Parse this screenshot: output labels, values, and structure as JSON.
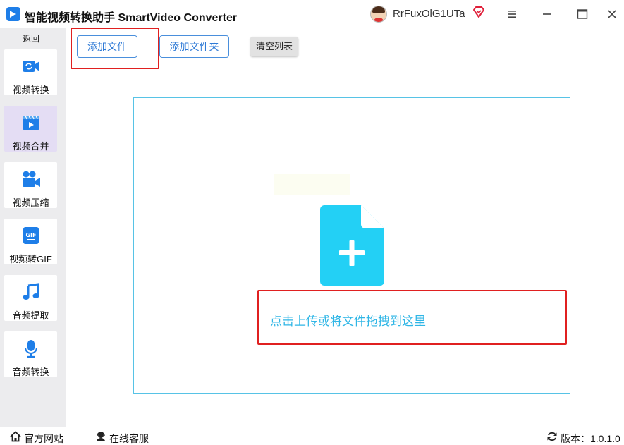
{
  "app": {
    "title": "智能视频转换助手 SmartVideo Converter",
    "username": "RrFuxOlG1UTa",
    "accent": "#2f7ad6"
  },
  "window_controls": {
    "icons": [
      "vip-diamond-icon",
      "menu-icon",
      "minimize-icon",
      "maximize-icon",
      "close-icon"
    ]
  },
  "sidebar": {
    "back_label": "返回",
    "items": [
      {
        "label": "视频转换",
        "icon": "video-convert-icon",
        "active": false
      },
      {
        "label": "视频合并",
        "icon": "video-merge-icon",
        "active": true
      },
      {
        "label": "视频压缩",
        "icon": "video-compress-icon",
        "active": false
      },
      {
        "label": "视频转GIF",
        "icon": "gif-icon",
        "active": false
      },
      {
        "label": "音频提取",
        "icon": "music-note-icon",
        "active": false
      },
      {
        "label": "音频转换",
        "icon": "microphone-icon",
        "active": false
      }
    ]
  },
  "toolbar": {
    "add_file": "添加文件",
    "add_folder": "添加文件夹",
    "clear_list": "清空列表"
  },
  "dropzone": {
    "upload_text": "点击上传或将文件拖拽到这里",
    "border_color": "#57c3e6",
    "icon_color": "#23d0f5"
  },
  "bottom": {
    "website": "官方网站",
    "support": "在线客服",
    "version": "版本：1.0.1.0"
  }
}
